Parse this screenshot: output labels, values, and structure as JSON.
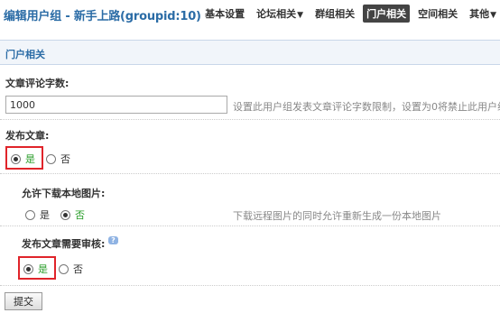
{
  "header": {
    "title": "编辑用户组 - 新手上路(groupid:10)",
    "nav": [
      {
        "label": "基本设置"
      },
      {
        "label": "论坛相关",
        "caret": "▼"
      },
      {
        "label": "群组相关"
      },
      {
        "label": "门户相关",
        "active": true
      },
      {
        "label": "空间相关"
      },
      {
        "label": "其他",
        "caret": "▼"
      }
    ]
  },
  "section": {
    "title": "门户相关"
  },
  "comment_limit": {
    "label": "文章评论字数:",
    "value": "1000",
    "hint": "设置此用户组发表文章评论字数限制，设置为0将禁止此用户组发"
  },
  "publish": {
    "label": "发布文章:",
    "yes": "是",
    "no": "否",
    "selected": "yes"
  },
  "download_images": {
    "label": "允许下载本地图片:",
    "yes": "是",
    "no": "否",
    "selected": "no",
    "hint": "下载远程图片的同时允许重新生成一份本地图片"
  },
  "need_audit": {
    "label": "发布文章需要审核:",
    "help_icon": "help-icon",
    "yes": "是",
    "no": "否",
    "selected": "yes"
  },
  "submit": {
    "label": "提交"
  },
  "colors": {
    "accent": "#2b6ca6",
    "highlight": "#e0242a",
    "yes_green": "#2a9d2a"
  }
}
